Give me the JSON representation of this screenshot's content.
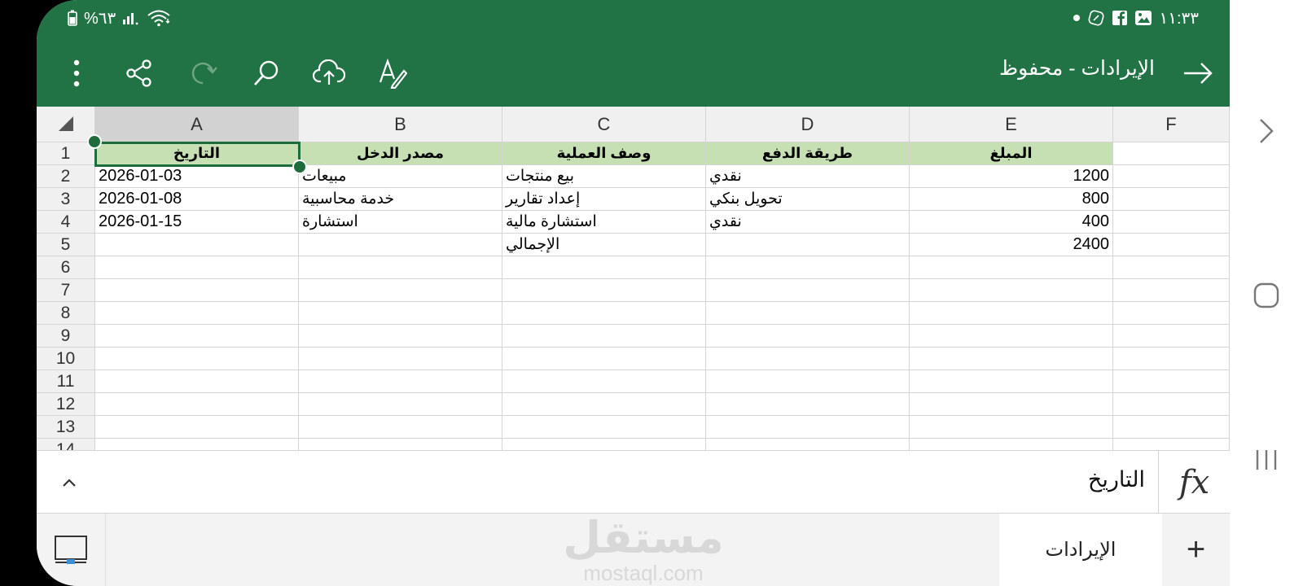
{
  "status_bar": {
    "battery_percent": "%٦٣",
    "time": "١١:٣٣"
  },
  "toolbar": {
    "title": "الإيرادات - محفوظ"
  },
  "sheet": {
    "columns": [
      "A",
      "B",
      "C",
      "D",
      "E",
      "F"
    ],
    "selected_column": "A",
    "rows": [
      "1",
      "2",
      "3",
      "4",
      "5",
      "6",
      "7",
      "8",
      "9",
      "10",
      "11",
      "12",
      "13",
      "14"
    ],
    "header_row": {
      "A": "التاريخ",
      "B": "مصدر الدخل",
      "C": "وصف العملية",
      "D": "طريقة الدفع",
      "E": "المبلغ"
    },
    "data_rows": [
      {
        "A": "2026-01-03",
        "B": "مبيعات",
        "C": "بيع منتجات",
        "D": "نقدي",
        "E": "1200"
      },
      {
        "A": "2026-01-08",
        "B": "خدمة محاسبية",
        "C": "إعداد تقارير",
        "D": "تحويل بنكي",
        "E": "800"
      },
      {
        "A": "2026-01-15",
        "B": "استشارة",
        "C": "استشارة مالية",
        "D": "نقدي",
        "E": "400"
      },
      {
        "A": "",
        "B": "",
        "C": "الإجمالي",
        "D": "",
        "E": "2400"
      }
    ]
  },
  "formula_bar": {
    "fx_label": "fx",
    "value": "التاريخ"
  },
  "sheet_tabs": {
    "active_tab": "الإيرادات",
    "add_label": "+"
  },
  "watermark": {
    "arabic": "مستقل",
    "latin": "mostaql.com"
  },
  "colors": {
    "brand_green": "#217346",
    "header_fill": "#c6e0b4",
    "selection": "#1e6b3c"
  }
}
